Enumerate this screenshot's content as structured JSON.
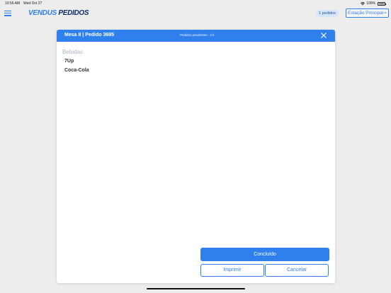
{
  "status_bar": {
    "time": "10:56 AM",
    "date": "Wed Oct 27",
    "battery": "100%"
  },
  "header": {
    "menu_icon": "hamburger-menu-icon",
    "logo_brand": "VENDUS",
    "logo_product": "PEDIDOS",
    "orders_badge": "1 pedidos",
    "station_select": "Estação Principal"
  },
  "modal": {
    "title": "Mesa 8 | Pedido 3695",
    "pending": "Pedidos pendentes - 1/1",
    "close_icon": "close-icon",
    "section_title": "Bebidas",
    "items": [
      {
        "name": "7Up"
      },
      {
        "name": "Coca-Cola"
      }
    ],
    "buttons": {
      "done": "Concluído",
      "print": "Imprimir",
      "cancel": "Cancelar"
    }
  },
  "colors": {
    "accent": "#2f80ed",
    "brand_dark": "#0d2a66",
    "section_title": "#aab4c3",
    "badge_bg": "#d6e6f9",
    "background": "#ededed"
  }
}
